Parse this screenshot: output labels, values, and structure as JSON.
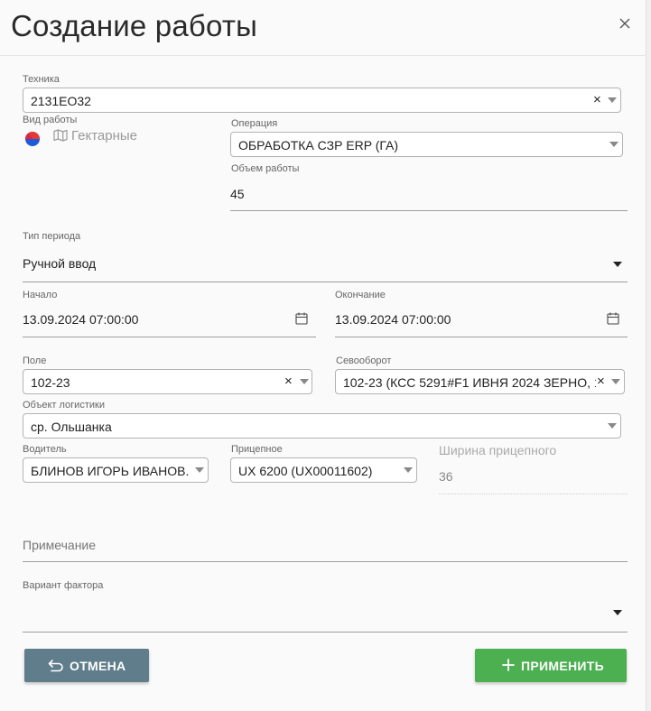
{
  "dialog": {
    "title": "Создание работы",
    "close_icon": "close-icon"
  },
  "form": {
    "equipment": {
      "label": "Техника",
      "value": "2131ЕО32",
      "clear": "×"
    },
    "work_type": {
      "label": "Вид работы",
      "value": "Гектарные",
      "icons": [
        "circle-split-icon",
        "map-icon"
      ]
    },
    "operation": {
      "label": "Операция",
      "value": "ОБРАБОТКА СЗР ERP (ГА)"
    },
    "work_volume": {
      "label": "Объем работы",
      "value": "45"
    },
    "period_type": {
      "label": "Тип периода",
      "value": "Ручной ввод"
    },
    "start": {
      "label": "Начало",
      "value": "13.09.2024 07:00:00"
    },
    "end": {
      "label": "Окончание",
      "value": "13.09.2024 07:00:00"
    },
    "field": {
      "label": "Поле",
      "value": "102-23",
      "clear": "×"
    },
    "crop_rotation": {
      "label": "Севооборот",
      "value": "102-23 (КСС 5291#F1 ИВНЯ 2024 ЗЕРНО, 1...",
      "clear": "×"
    },
    "logistics_object": {
      "label": "Объект логистики",
      "value": "ср. Ольшанка"
    },
    "driver": {
      "label": "Водитель",
      "value": "БЛИНОВ ИГОРЬ ИВАНОВ..."
    },
    "trailer": {
      "label": "Прицепное",
      "value": "UX 6200 (UX00011602)"
    },
    "trailer_width": {
      "label": "Ширина прицепного",
      "value": "36"
    },
    "note": {
      "placeholder": "Примечание"
    },
    "factor_variant": {
      "label": "Вариант фактора",
      "value": ""
    }
  },
  "buttons": {
    "cancel": "ОТМЕНА",
    "apply": "ПРИМЕНИТЬ"
  },
  "colors": {
    "cancel_bg": "#607d8b",
    "apply_bg": "#4caf50",
    "icon_red": "#e53935",
    "icon_blue": "#1e5bd8"
  }
}
